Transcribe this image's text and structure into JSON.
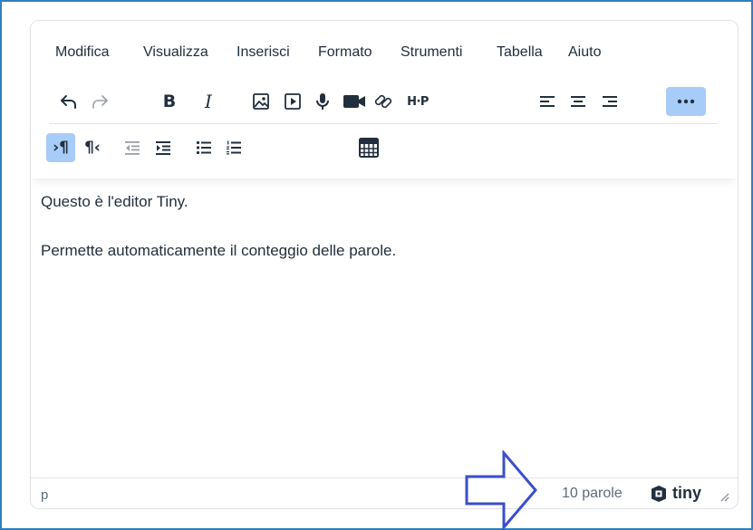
{
  "menubar": {
    "items": [
      "Modifica",
      "Visualizza",
      "Inserisci",
      "Formato",
      "Strumenti",
      "Tabella",
      "Aiuto"
    ]
  },
  "toolbar": {
    "row1": [
      {
        "name": "undo-icon",
        "state": "enabled"
      },
      {
        "name": "redo-icon",
        "state": "disabled"
      },
      {
        "name": "bold-button",
        "label": "B"
      },
      {
        "name": "italic-button",
        "label": "I"
      },
      {
        "name": "image-icon"
      },
      {
        "name": "media-icon"
      },
      {
        "name": "microphone-icon"
      },
      {
        "name": "video-camera-icon"
      },
      {
        "name": "link-icon"
      },
      {
        "name": "h5p-button",
        "label": "H·P"
      },
      {
        "name": "align-left-icon"
      },
      {
        "name": "align-center-icon"
      },
      {
        "name": "align-right-icon"
      },
      {
        "name": "more-icon",
        "state": "active"
      }
    ],
    "row2": [
      {
        "name": "ltr-icon",
        "state": "active"
      },
      {
        "name": "rtl-icon"
      },
      {
        "name": "outdent-icon",
        "state": "disabled"
      },
      {
        "name": "indent-icon"
      },
      {
        "name": "bullet-list-icon"
      },
      {
        "name": "numbered-list-icon"
      },
      {
        "name": "calculator-icon"
      }
    ]
  },
  "content": {
    "paragraphs": [
      "Questo è l'editor Tiny.",
      "Permette automaticamente il conteggio delle parole."
    ]
  },
  "statusbar": {
    "path": "p",
    "word_count": "10 parole",
    "brand": "tiny"
  },
  "colors": {
    "frame": "#2f7fbf",
    "active_button": "#a6ccf7",
    "arrow": "#3b4fc8",
    "text": "#222f3e"
  }
}
